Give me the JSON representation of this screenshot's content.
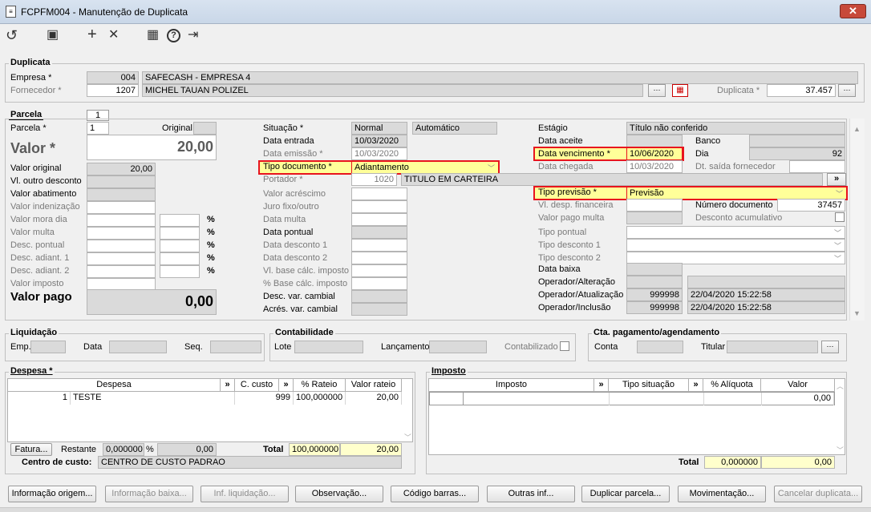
{
  "window": {
    "title": "FCPFM004 - Manutenção de Duplicata",
    "close": "✕"
  },
  "toolbar": {
    "undo": "↺",
    "save": "▣",
    "add": "+",
    "cancel": "✕",
    "calendar": "▦",
    "help": "?",
    "exit": "⇥"
  },
  "duplicata": {
    "title": "Duplicata",
    "empresa_label": "Empresa *",
    "empresa_code": "004",
    "empresa_name": "SAFECASH - EMPRESA 4",
    "fornecedor_label": "Fornecedor *",
    "fornecedor_code": "1207",
    "fornecedor_name": "MICHEL TAUAN POLIZEL",
    "duplicata_label": "Duplicata *",
    "duplicata_value": "37.457"
  },
  "parcela_tab": {
    "title": "Parcela",
    "number": "1"
  },
  "parcela": {
    "parcela_label": "Parcela *",
    "parcela_value": "1",
    "original_label": "Original",
    "valor_label": "Valor *",
    "valor_value": "20,00",
    "valor_pago_label": "Valor pago",
    "valor_pago_value": "0,00",
    "rows": [
      {
        "label": "Valor original",
        "value": "20,00"
      },
      {
        "label": "Vl. outro desconto",
        "value": ""
      },
      {
        "label": "Valor abatimento",
        "value": ""
      },
      {
        "label": "Valor indenização",
        "value": ""
      },
      {
        "label": "Valor mora dia",
        "value": "",
        "pct": "%"
      },
      {
        "label": "Valor multa",
        "value": "",
        "pct": "%"
      },
      {
        "label": "Desc. pontual",
        "value": "",
        "pct": "%"
      },
      {
        "label": "Desc. adiant. 1",
        "value": "",
        "pct": "%"
      },
      {
        "label": "Desc. adiant. 2",
        "value": "",
        "pct": "%"
      },
      {
        "label": "Valor imposto",
        "value": ""
      }
    ]
  },
  "mid": {
    "situacao_label": "Situação *",
    "situacao_value": "Normal",
    "situacao_extra": "Automático",
    "data_entrada_label": "Data entrada",
    "data_entrada_value": "10/03/2020",
    "data_emissao_label": "Data emissão *",
    "data_emissao_value": "10/03/2020",
    "tipo_documento_label": "Tipo documento *",
    "tipo_documento_value": "Adiantamento",
    "portador_label": "Portador *",
    "portador_code": "1020",
    "portador_name": "TITULO EM CARTEIRA",
    "valor_acrescimo_label": "Valor acréscimo",
    "juro_label": "Juro fixo/outro",
    "data_multa_label": "Data multa",
    "data_pontual_label": "Data pontual",
    "data_desconto1_label": "Data desconto 1",
    "data_desconto2_label": "Data desconto 2",
    "vl_base_label": "Vl. base cálc. imposto",
    "pct_base_label": "% Base cálc. imposto",
    "desc_var_label": "Desc. var. cambial",
    "acres_var_label": "Acrés. var. cambial"
  },
  "right": {
    "estagio_label": "Estágio",
    "estagio_value": "Título não conferido",
    "data_aceite_label": "Data aceite",
    "banco_label": "Banco",
    "data_vencimento_label": "Data vencimento *",
    "data_vencimento_value": "10/06/2020",
    "dia_label": "Dia",
    "dia_value": "92",
    "data_chegada_label": "Data chegada",
    "data_chegada_value": "10/03/2020",
    "dt_saida_label": "Dt. saída fornecedor",
    "tipo_previsao_label": "Tipo previsão *",
    "tipo_previsao_value": "Previsão",
    "vl_desp_label": "Vl. desp. financeira",
    "numero_documento_label": "Número documento",
    "numero_documento_value": "37457",
    "valor_pago_multa_label": "Valor pago multa",
    "desconto_acumulativo_label": "Desconto acumulativo",
    "tipo_pontual_label": "Tipo pontual",
    "tipo_desconto1_label": "Tipo desconto 1",
    "tipo_desconto2_label": "Tipo desconto 2",
    "data_baixa_label": "Data baixa",
    "operador_alteracao_label": "Operador/Alteração",
    "operador_atualizacao_label": "Operador/Atualização",
    "operador_atualizacao_code": "999998",
    "operador_atualizacao_date": "22/04/2020 15:22:58",
    "operador_inclusao_label": "Operador/Inclusão",
    "operador_inclusao_code": "999998",
    "operador_inclusao_date": "22/04/2020 15:22:58"
  },
  "liquidacao": {
    "title": "Liquidação",
    "emp_label": "Emp.",
    "data_label": "Data",
    "seq_label": "Seq."
  },
  "contabilidade": {
    "title": "Contabilidade",
    "lote_label": "Lote",
    "lancamento_label": "Lançamento",
    "contabilizado_label": "Contabilizado"
  },
  "cta": {
    "title": "Cta. pagamento/agendamento",
    "conta_label": "Conta",
    "titular_label": "Titular"
  },
  "despesa": {
    "title": "Despesa *",
    "headers": {
      "despesa": "Despesa",
      "c_custo": "C. custo",
      "rateio": "% Rateio",
      "valor_rateio": "Valor rateio",
      "more": "»"
    },
    "row": {
      "num": "1",
      "name": "TESTE",
      "c_custo": "999",
      "rateio": "100,000000",
      "valor_rateio": "20,00"
    },
    "fatura_label": "Fatura...",
    "restante_label": "Restante",
    "restante_pct": "0,000000",
    "restante_pct_sign": "%",
    "restante_valor": "0,00",
    "total_label": "Total",
    "total_pct": "100,000000",
    "total_valor": "20,00",
    "centro_label": "Centro de custo:",
    "centro_value": "CENTRO DE CUSTO PADRAO"
  },
  "imposto": {
    "title": "Imposto",
    "headers": {
      "imposto": "Imposto",
      "tipo_situacao": "Tipo situação",
      "aliquota": "% Alíquota",
      "valor": "Valor",
      "more": "»"
    },
    "row_valor": "0,00",
    "total_label": "Total",
    "total_pct": "0,000000",
    "total_valor": "0,00"
  },
  "buttons": [
    {
      "label": "Informação origem...",
      "enabled": true
    },
    {
      "label": "Informação baixa...",
      "enabled": false
    },
    {
      "label": "Inf. liquidação...",
      "enabled": false
    },
    {
      "label": "Observação...",
      "enabled": true
    },
    {
      "label": "Código barras...",
      "enabled": true
    },
    {
      "label": "Outras inf...",
      "enabled": true
    },
    {
      "label": "Duplicar parcela...",
      "enabled": true
    },
    {
      "label": "Movimentação...",
      "enabled": true
    },
    {
      "label": "Cancelar duplicata...",
      "enabled": false
    }
  ],
  "colors": {
    "highlight": "#e8141e",
    "yellow": "#ffff99",
    "readonly": "#dadada"
  }
}
